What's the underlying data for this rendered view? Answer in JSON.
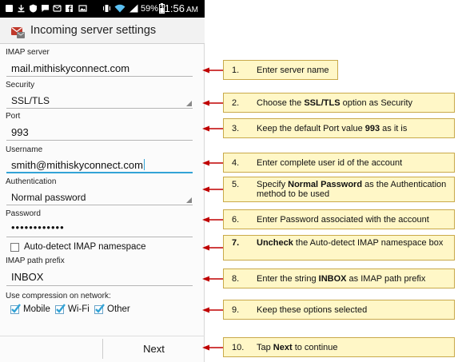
{
  "status_bar": {
    "battery_percent": "59%",
    "time": "11:56",
    "time_suffix": "AM"
  },
  "action_bar": {
    "title": "Incoming server settings",
    "icon": "envelope-icon"
  },
  "form": {
    "imap_server": {
      "label": "IMAP server",
      "value": "mail.mithiskyconnect.com"
    },
    "security": {
      "label": "Security",
      "value": "SSL/TLS"
    },
    "port": {
      "label": "Port",
      "value": "993"
    },
    "username": {
      "label": "Username",
      "value": "smith@mithiskyconnect.com"
    },
    "authentication": {
      "label": "Authentication",
      "value": "Normal password"
    },
    "password": {
      "label": "Password",
      "value": "••••••••••••"
    },
    "auto_detect": {
      "label": "Auto-detect IMAP namespace",
      "checked": false
    },
    "path_prefix": {
      "label": "IMAP path prefix",
      "value": "INBOX"
    },
    "compression": {
      "label": "Use compression on network:",
      "options": [
        {
          "label": "Mobile",
          "checked": true
        },
        {
          "label": "Wi-Fi",
          "checked": true
        },
        {
          "label": "Other",
          "checked": true
        }
      ]
    }
  },
  "buttons": {
    "next": "Next"
  },
  "annotations": [
    {
      "num": "1.",
      "pre": "Enter server name",
      "bold": "",
      "post": ""
    },
    {
      "num": "2.",
      "pre": "Choose the ",
      "bold": "SSL/TLS",
      "post": " option as Security"
    },
    {
      "num": "3.",
      "pre": "Keep the default Port value ",
      "bold": "993",
      "post": " as it is"
    },
    {
      "num": "4.",
      "pre": "Enter complete user id of the account",
      "bold": "",
      "post": ""
    },
    {
      "num": "5.",
      "pre": "Specify ",
      "bold": "Normal Password",
      "post": " as the Authentication method to be used"
    },
    {
      "num": "6.",
      "pre": "Enter Password associated with the account",
      "bold": "",
      "post": ""
    },
    {
      "num": "7.",
      "pre": "",
      "bold": "Uncheck",
      "post": " the Auto-detect IMAP  namespace box"
    },
    {
      "num": "8.",
      "pre": "Enter the string ",
      "bold": "INBOX",
      "post": "  as IMAP  path prefix"
    },
    {
      "num": "9.",
      "pre": "Keep these options selected",
      "bold": "",
      "post": ""
    },
    {
      "num": "10.",
      "pre": "Tap ",
      "bold": "Next",
      "post": " to continue"
    }
  ],
  "colors": {
    "arrow": "#c00000",
    "note_fill": "#fff7c7",
    "note_border": "#c9a94a",
    "focus_underline": "#33a3d6",
    "checkbox_check": "#33a3d6"
  }
}
